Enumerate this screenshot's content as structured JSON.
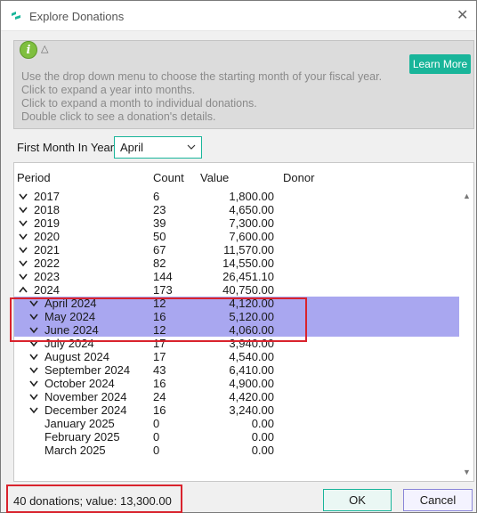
{
  "window": {
    "title": "Explore Donations",
    "close_glyph": "✕",
    "icon": "app-logo-icon"
  },
  "info": {
    "icon": "info-icon",
    "info_glyph": "i",
    "collapse_glyph": "△",
    "learn_more": "Learn More",
    "lines": [
      "Use the drop down menu to choose the starting month of your fiscal year.",
      "Click to expand a year into months.",
      "Click to expand a month to individual donations.",
      "Double click to see a donation's details."
    ]
  },
  "first_month": {
    "label": "First Month In Year",
    "value": "April"
  },
  "table": {
    "headers": [
      "Period",
      "Count",
      "Value",
      "Donor"
    ],
    "rows": [
      {
        "period": "2017",
        "count": "6",
        "value": "1,800.00",
        "chevron": "down",
        "level": 0,
        "selected": false
      },
      {
        "period": "2018",
        "count": "23",
        "value": "4,650.00",
        "chevron": "down",
        "level": 0,
        "selected": false
      },
      {
        "period": "2019",
        "count": "39",
        "value": "7,300.00",
        "chevron": "down",
        "level": 0,
        "selected": false
      },
      {
        "period": "2020",
        "count": "50",
        "value": "7,600.00",
        "chevron": "down",
        "level": 0,
        "selected": false
      },
      {
        "period": "2021",
        "count": "67",
        "value": "11,570.00",
        "chevron": "down",
        "level": 0,
        "selected": false
      },
      {
        "period": "2022",
        "count": "82",
        "value": "14,550.00",
        "chevron": "down",
        "level": 0,
        "selected": false
      },
      {
        "period": "2023",
        "count": "144",
        "value": "26,451.10",
        "chevron": "down",
        "level": 0,
        "selected": false
      },
      {
        "period": "2024",
        "count": "173",
        "value": "40,750.00",
        "chevron": "up",
        "level": 0,
        "selected": false
      },
      {
        "period": "April 2024",
        "count": "12",
        "value": "4,120.00",
        "chevron": "down",
        "level": 1,
        "selected": true
      },
      {
        "period": "May 2024",
        "count": "16",
        "value": "5,120.00",
        "chevron": "down",
        "level": 1,
        "selected": true
      },
      {
        "period": "June 2024",
        "count": "12",
        "value": "4,060.00",
        "chevron": "down",
        "level": 1,
        "selected": true
      },
      {
        "period": "July 2024",
        "count": "17",
        "value": "3,940.00",
        "chevron": "down",
        "level": 1,
        "selected": false
      },
      {
        "period": "August 2024",
        "count": "17",
        "value": "4,540.00",
        "chevron": "down",
        "level": 1,
        "selected": false
      },
      {
        "period": "September 2024",
        "count": "43",
        "value": "6,410.00",
        "chevron": "down",
        "level": 1,
        "selected": false
      },
      {
        "period": "October 2024",
        "count": "16",
        "value": "4,900.00",
        "chevron": "down",
        "level": 1,
        "selected": false
      },
      {
        "period": "November 2024",
        "count": "24",
        "value": "4,420.00",
        "chevron": "down",
        "level": 1,
        "selected": false
      },
      {
        "period": "December 2024",
        "count": "16",
        "value": "3,240.00",
        "chevron": "down",
        "level": 1,
        "selected": false
      },
      {
        "period": "January 2025",
        "count": "0",
        "value": "0.00",
        "chevron": "none",
        "level": 1,
        "selected": false
      },
      {
        "period": "February 2025",
        "count": "0",
        "value": "0.00",
        "chevron": "none",
        "level": 1,
        "selected": false
      },
      {
        "period": "March 2025",
        "count": "0",
        "value": "0.00",
        "chevron": "none",
        "level": 1,
        "selected": false
      }
    ]
  },
  "status": "40 donations; value: 13,300.00",
  "buttons": {
    "ok": "OK",
    "cancel": "Cancel"
  },
  "colors": {
    "accent": "#19b59a",
    "selection": "#a9a7f0",
    "highlight": "#d9232d",
    "info_icon": "#7fbf3f"
  }
}
